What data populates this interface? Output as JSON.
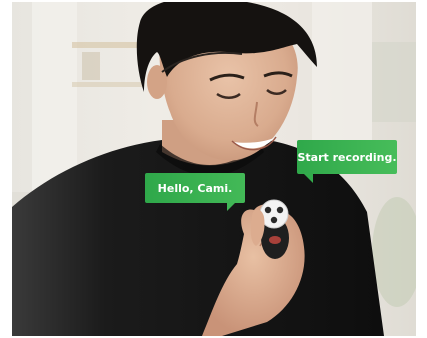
{
  "bubbles": {
    "hello": "Hello, Cami.",
    "record": "Start recording."
  },
  "colors": {
    "bubble_green": "#3cb252",
    "shirt": "#151515",
    "background": "#e9e6e1",
    "device": "#f2f2f2"
  }
}
